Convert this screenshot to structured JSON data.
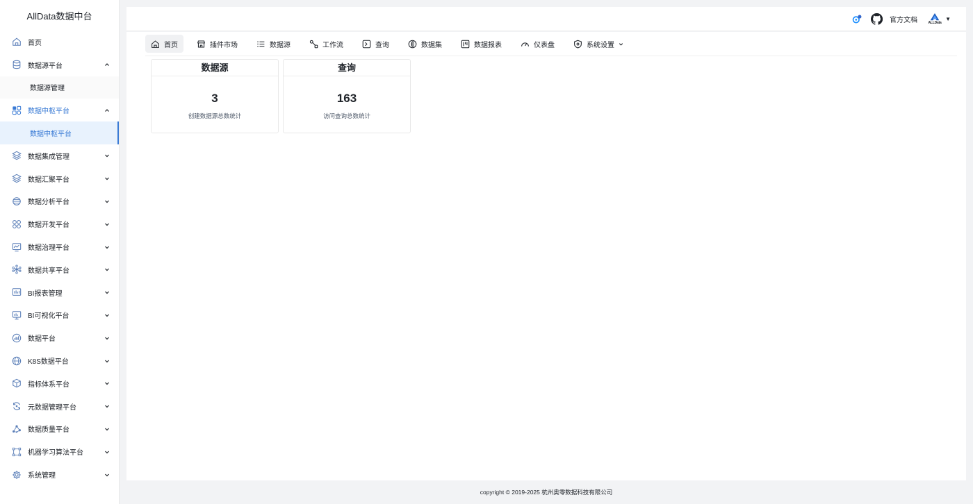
{
  "brand": {
    "title": "AllData数据中台"
  },
  "sidebar": {
    "items": [
      {
        "label": "首页",
        "icon": "home-icon",
        "chevron": ""
      },
      {
        "label": "数据源平台",
        "icon": "database-icon",
        "chevron": "up",
        "children": [
          {
            "label": "数据源管理",
            "selected": false
          }
        ]
      },
      {
        "label": "数据中枢平台",
        "icon": "apps-icon",
        "chevron": "up",
        "active": true,
        "children": [
          {
            "label": "数据中枢平台",
            "selected": true
          }
        ]
      },
      {
        "label": "数据集成管理",
        "icon": "layers-icon",
        "chevron": "down"
      },
      {
        "label": "数据汇聚平台",
        "icon": "layers-icon",
        "chevron": "down"
      },
      {
        "label": "数据分析平台",
        "icon": "globe-icon",
        "chevron": "down"
      },
      {
        "label": "数据开发平台",
        "icon": "nodes-icon",
        "chevron": "down"
      },
      {
        "label": "数据治理平台",
        "icon": "monitor-chart-icon",
        "chevron": "down"
      },
      {
        "label": "数据共享平台",
        "icon": "share-network-icon",
        "chevron": "down"
      },
      {
        "label": "BI报表管理",
        "icon": "report-icon",
        "chevron": "down"
      },
      {
        "label": "BI可视化平台",
        "icon": "screen-icon",
        "chevron": "down"
      },
      {
        "label": "数据平台",
        "icon": "bar-chart-icon",
        "chevron": "down"
      },
      {
        "label": "K8S数据平台",
        "icon": "cloud-globe-icon",
        "chevron": "down"
      },
      {
        "label": "指标体系平台",
        "icon": "cube-icon",
        "chevron": "down"
      },
      {
        "label": "元数据管理平台",
        "icon": "refresh-icon",
        "chevron": "down"
      },
      {
        "label": "数据质量平台",
        "icon": "graph-icon",
        "chevron": "down"
      },
      {
        "label": "机器学习算法平台",
        "icon": "vector-icon",
        "chevron": "down"
      },
      {
        "label": "系统管理",
        "icon": "gear-icon",
        "chevron": "down"
      }
    ]
  },
  "header": {
    "doc_link": "官方文档",
    "avatar_text": "ALLData",
    "avatar_caret": "▼"
  },
  "tabs": [
    {
      "label": "首页",
      "icon": "home-icon",
      "active": true
    },
    {
      "label": "插件市场",
      "icon": "store-icon"
    },
    {
      "label": "数据源",
      "icon": "list-icon"
    },
    {
      "label": "工作流",
      "icon": "workflow-icon"
    },
    {
      "label": "查询",
      "icon": "terminal-icon"
    },
    {
      "label": "数据集",
      "icon": "dataset-icon"
    },
    {
      "label": "数据报表",
      "icon": "report-board-icon"
    },
    {
      "label": "仪表盘",
      "icon": "gauge-icon"
    },
    {
      "label": "系统设置",
      "icon": "shield-icon",
      "has_dropdown": true
    }
  ],
  "cards": [
    {
      "title": "数据源",
      "value": "3",
      "desc": "创建数据源总数统计"
    },
    {
      "title": "查询",
      "value": "163",
      "desc": "访问查询总数统计"
    }
  ],
  "footer": {
    "text": "copyright © 2019-2025 杭州奥零数据科技有限公司"
  },
  "colors": {
    "accent": "#3a7bd5",
    "selected_bg": "#e8f2fd"
  }
}
